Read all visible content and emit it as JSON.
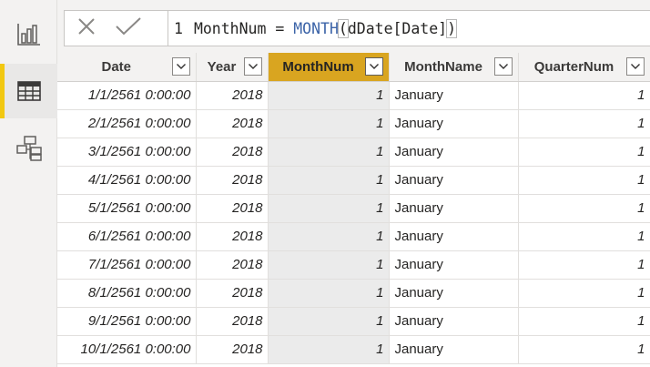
{
  "formula": {
    "line_number": "1",
    "prefix": "MonthNum = ",
    "function_name": "MONTH",
    "open_paren": "(",
    "argument": "dDate[Date]",
    "close_paren": ")"
  },
  "formula_buttons": {
    "cancel_icon": "close-icon",
    "commit_icon": "checkmark-icon"
  },
  "sidebar": {
    "items": [
      {
        "name": "report-view",
        "icon": "bar-chart-icon",
        "active": false
      },
      {
        "name": "data-view",
        "icon": "table-icon",
        "active": true
      },
      {
        "name": "model-view",
        "icon": "model-icon",
        "active": false
      }
    ]
  },
  "colors": {
    "accent": "#f2c811",
    "selected_header": "#d9a520",
    "function_blue": "#3c64a8"
  },
  "table": {
    "selected_column": "MonthNum",
    "columns": [
      {
        "label": "Date"
      },
      {
        "label": "Year"
      },
      {
        "label": "MonthNum"
      },
      {
        "label": "MonthName"
      },
      {
        "label": "QuarterNum"
      }
    ],
    "rows": [
      [
        "1/1/2561 0:00:00",
        "2018",
        "1",
        "January",
        "1"
      ],
      [
        "2/1/2561 0:00:00",
        "2018",
        "1",
        "January",
        "1"
      ],
      [
        "3/1/2561 0:00:00",
        "2018",
        "1",
        "January",
        "1"
      ],
      [
        "4/1/2561 0:00:00",
        "2018",
        "1",
        "January",
        "1"
      ],
      [
        "5/1/2561 0:00:00",
        "2018",
        "1",
        "January",
        "1"
      ],
      [
        "6/1/2561 0:00:00",
        "2018",
        "1",
        "January",
        "1"
      ],
      [
        "7/1/2561 0:00:00",
        "2018",
        "1",
        "January",
        "1"
      ],
      [
        "8/1/2561 0:00:00",
        "2018",
        "1",
        "January",
        "1"
      ],
      [
        "9/1/2561 0:00:00",
        "2018",
        "1",
        "January",
        "1"
      ],
      [
        "10/1/2561 0:00:00",
        "2018",
        "1",
        "January",
        "1"
      ]
    ]
  }
}
